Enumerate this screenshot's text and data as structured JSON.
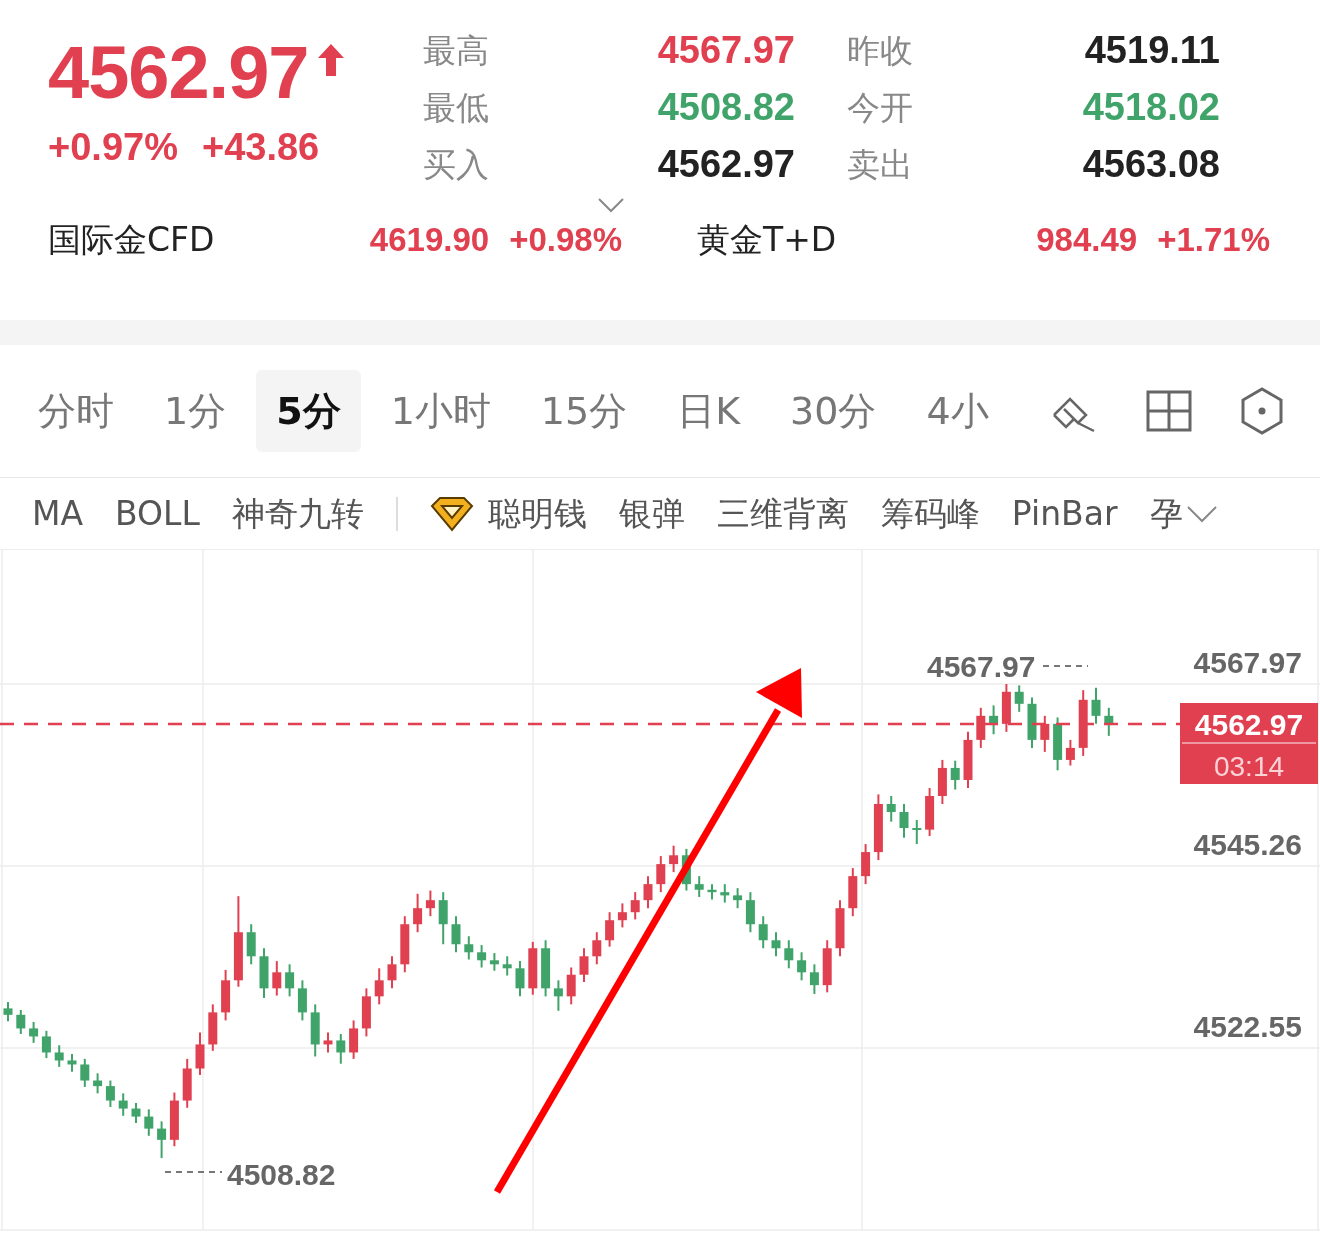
{
  "quote": {
    "price": "4562.97",
    "rising": true,
    "change_pct": "+0.97%",
    "change": "+43.86"
  },
  "stats": [
    {
      "label": "最高",
      "value": "4567.97",
      "color": "#e0404f"
    },
    {
      "label": "昨收",
      "value": "4519.11",
      "color": "#222222"
    },
    {
      "label": "最低",
      "value": "4508.82",
      "color": "#3fa36a"
    },
    {
      "label": "今开",
      "value": "4518.02",
      "color": "#3fa36a"
    },
    {
      "label": "买入",
      "value": "4562.97",
      "color": "#222222"
    },
    {
      "label": "卖出",
      "value": "4563.08",
      "color": "#222222"
    }
  ],
  "related": [
    {
      "name": "国际金CFD",
      "price": "4619.90",
      "change": "+0.98%",
      "color": "#e0404f"
    },
    {
      "name": "黄金T+D",
      "price": "984.49",
      "change": "+1.71%",
      "color": "#e0404f"
    }
  ],
  "timeframes": [
    {
      "label": "分时",
      "selected": false
    },
    {
      "label": "1分",
      "selected": false
    },
    {
      "label": "5分",
      "selected": true
    },
    {
      "label": "1小时",
      "selected": false
    },
    {
      "label": "15分",
      "selected": false
    },
    {
      "label": "日K",
      "selected": false
    },
    {
      "label": "30分",
      "selected": false
    },
    {
      "label": "4小",
      "selected": false
    }
  ],
  "indicators": [
    {
      "label": "MA",
      "kind": "plain"
    },
    {
      "label": "BOLL",
      "kind": "plain"
    },
    {
      "label": "神奇九转",
      "kind": "plain"
    },
    {
      "label": "聪明钱",
      "kind": "premium"
    },
    {
      "label": "银弹",
      "kind": "plain"
    },
    {
      "label": "三维背离",
      "kind": "plain"
    },
    {
      "label": "筹码峰",
      "kind": "plain"
    },
    {
      "label": "PinBar",
      "kind": "plain"
    },
    {
      "label": "孕",
      "kind": "plain"
    }
  ],
  "chart": {
    "high_marker": "4567.97",
    "low_marker": "4508.82",
    "last_price": "4562.97",
    "countdown": "03:14",
    "chart_data": {
      "type": "candlestick",
      "ylim": [
        4499.85,
        4584.69
      ],
      "yticks": [
        4567.97,
        4545.26,
        4522.55
      ],
      "grid": true,
      "ohlc": [
        [
          4527.5,
          4528.3,
          4525.9,
          4526.7
        ],
        [
          4526.7,
          4527.3,
          4524.3,
          4525
        ],
        [
          4525,
          4525.8,
          4523.2,
          4524
        ],
        [
          4524,
          4524.7,
          4521.3,
          4522
        ],
        [
          4522,
          4522.9,
          4520.2,
          4521
        ],
        [
          4521,
          4521.8,
          4519.6,
          4520.5
        ],
        [
          4520.5,
          4521.2,
          4517.7,
          4518.5
        ],
        [
          4518.5,
          4519.4,
          4516.9,
          4517.8
        ],
        [
          4517.8,
          4518.5,
          4515.2,
          4516
        ],
        [
          4516,
          4516.9,
          4514.1,
          4515
        ],
        [
          4515,
          4515.7,
          4513.2,
          4514
        ],
        [
          4514,
          4514.9,
          4511.6,
          4512.5
        ],
        [
          4512.5,
          4513.4,
          4508.82,
          4511.1
        ],
        [
          4511.1,
          4517,
          4510.3,
          4516
        ],
        [
          4516,
          4521.2,
          4515.1,
          4520
        ],
        [
          4520,
          4524.5,
          4519.2,
          4523
        ],
        [
          4523,
          4528,
          4522.2,
          4527
        ],
        [
          4527,
          4532.3,
          4526,
          4531
        ],
        [
          4531,
          4541.5,
          4530.2,
          4537
        ],
        [
          4537,
          4538,
          4533,
          4534
        ],
        [
          4534,
          4535,
          4528.8,
          4530
        ],
        [
          4530,
          4533.4,
          4529.1,
          4532
        ],
        [
          4532,
          4533,
          4529,
          4530
        ],
        [
          4530,
          4531,
          4526,
          4527
        ],
        [
          4527,
          4528,
          4521.5,
          4523
        ],
        [
          4523,
          4524.5,
          4522,
          4523.5
        ],
        [
          4523.5,
          4524.3,
          4520.6,
          4522
        ],
        [
          4522,
          4526,
          4521.2,
          4525
        ],
        [
          4525,
          4530,
          4524,
          4529
        ],
        [
          4529,
          4532.5,
          4528,
          4531
        ],
        [
          4531,
          4534,
          4530,
          4533
        ],
        [
          4533,
          4539,
          4532,
          4538
        ],
        [
          4538,
          4541.8,
          4537,
          4540
        ],
        [
          4540,
          4542.2,
          4539,
          4541
        ],
        [
          4541,
          4542,
          4535.5,
          4538
        ],
        [
          4538,
          4539,
          4534.5,
          4535.5
        ],
        [
          4535.5,
          4536.5,
          4533.6,
          4534.5
        ],
        [
          4534.5,
          4535.4,
          4532.6,
          4533.5
        ],
        [
          4533.5,
          4534.4,
          4532.2,
          4533
        ],
        [
          4533,
          4534,
          4531.6,
          4532.5
        ],
        [
          4532.5,
          4533.4,
          4529,
          4530
        ],
        [
          4530,
          4535.8,
          4529.2,
          4535
        ],
        [
          4535,
          4536,
          4529,
          4530
        ],
        [
          4530,
          4531,
          4527.2,
          4529
        ],
        [
          4529,
          4532.6,
          4528,
          4531.7
        ],
        [
          4531.7,
          4535,
          4530.8,
          4534
        ],
        [
          4534,
          4537,
          4533,
          4536
        ],
        [
          4536,
          4539.5,
          4535.2,
          4538.5
        ],
        [
          4538.5,
          4540.6,
          4537.6,
          4539.5
        ],
        [
          4539.5,
          4542,
          4538.6,
          4541
        ],
        [
          4541,
          4544,
          4540,
          4543
        ],
        [
          4543,
          4546.5,
          4542,
          4545.5
        ],
        [
          4545.5,
          4547.8,
          4544.5,
          4546.6
        ],
        [
          4546.6,
          4547.4,
          4542.2,
          4543
        ],
        [
          4543,
          4544,
          4541.4,
          4542.3
        ],
        [
          4542.3,
          4543,
          4541.1,
          4542
        ],
        [
          4542,
          4543,
          4540.7,
          4541.6
        ],
        [
          4541.6,
          4542.5,
          4540,
          4541
        ],
        [
          4541,
          4542,
          4537,
          4538
        ],
        [
          4538,
          4539,
          4535,
          4536
        ],
        [
          4536,
          4537,
          4534,
          4535
        ],
        [
          4535,
          4536,
          4532.5,
          4533.5
        ],
        [
          4533.5,
          4534.5,
          4531,
          4532
        ],
        [
          4532,
          4533,
          4529.3,
          4530.4
        ],
        [
          4530.4,
          4536,
          4529.5,
          4535
        ],
        [
          4535,
          4541,
          4534,
          4540
        ],
        [
          4540,
          4545,
          4539,
          4544
        ],
        [
          4544,
          4548,
          4543,
          4547
        ],
        [
          4547,
          4554.2,
          4546,
          4553
        ],
        [
          4553,
          4554,
          4550.8,
          4552
        ],
        [
          4552,
          4553,
          4548.8,
          4550
        ],
        [
          4550,
          4551,
          4548,
          4549.8
        ],
        [
          4549.8,
          4555,
          4549,
          4554
        ],
        [
          4554,
          4558.5,
          4553,
          4557.5
        ],
        [
          4557.5,
          4558.4,
          4554.8,
          4556
        ],
        [
          4556,
          4562,
          4555,
          4561
        ],
        [
          4561,
          4565,
          4560,
          4564
        ],
        [
          4564,
          4565.3,
          4561.7,
          4563
        ],
        [
          4563,
          4567.97,
          4562,
          4567
        ],
        [
          4567,
          4567.8,
          4564.5,
          4565.5
        ],
        [
          4565.5,
          4566.3,
          4560,
          4561
        ],
        [
          4561,
          4564,
          4559.5,
          4563
        ],
        [
          4563,
          4563.8,
          4557.2,
          4558.5
        ],
        [
          4558.5,
          4561,
          4557.8,
          4560
        ],
        [
          4560,
          4567.2,
          4559,
          4566
        ],
        [
          4566,
          4567.5,
          4563,
          4564
        ],
        [
          4564,
          4565,
          4561.5,
          4562.97
        ]
      ]
    }
  }
}
